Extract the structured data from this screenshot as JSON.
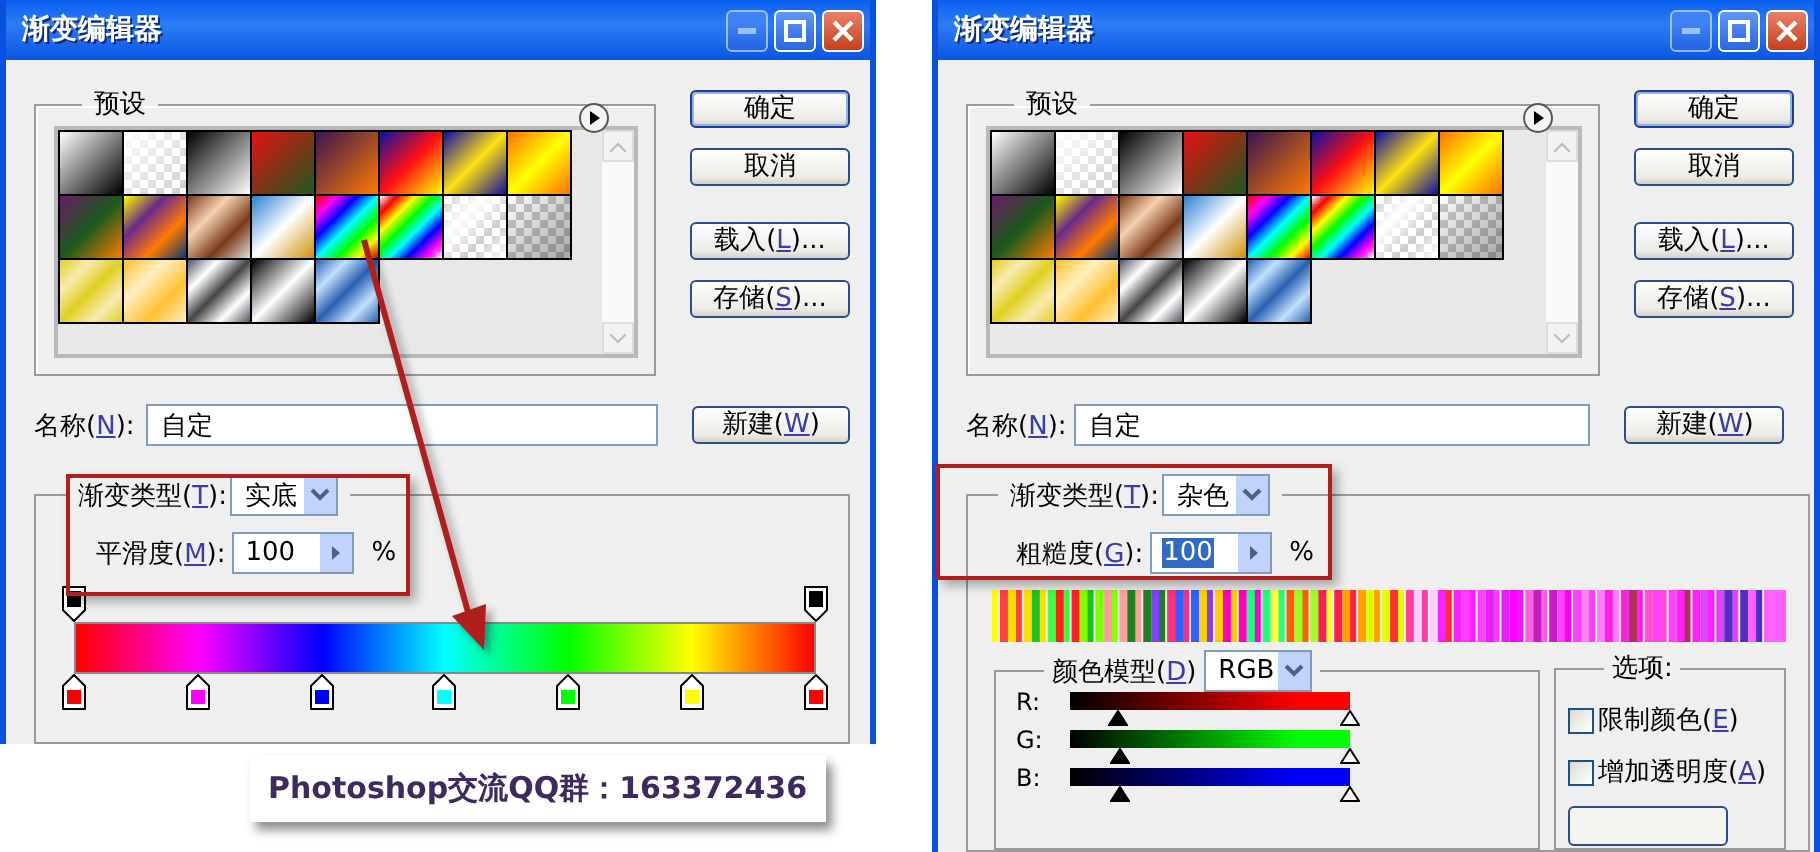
{
  "dialogs": [
    {
      "kind": "solid",
      "title": "渐变编辑器",
      "presets_label": "预设",
      "buttons": [
        {
          "label": {
            "before": "确定"
          },
          "default": true
        },
        {
          "label": {
            "before": "取消"
          },
          "default": false
        },
        {
          "label": {
            "before": "载入(",
            "key": "L",
            "after": ")..."
          },
          "default": false
        },
        {
          "label": {
            "before": "存储(",
            "key": "S",
            "after": ")..."
          },
          "default": false
        }
      ],
      "name_field": {
        "label": {
          "before": "名称(",
          "key": "N",
          "after": "):"
        },
        "value": "自定"
      },
      "new_button": {
        "before": "新建(",
        "key": "W",
        "after": ")"
      },
      "gradient_type": {
        "label": {
          "before": "渐变类型(",
          "key": "T",
          "after": "):"
        },
        "value": "实底"
      },
      "amount": {
        "label": {
          "before": "平滑度(",
          "key": "M",
          "after": "):"
        },
        "value": "100",
        "unit": "%",
        "selected": false
      },
      "opacity_stops": [
        {
          "color": "#000000"
        },
        {
          "color": "#000000"
        }
      ],
      "color_stops": [
        {
          "color": "#ff0000"
        },
        {
          "color": "#ff00ff"
        },
        {
          "color": "#0000ff"
        },
        {
          "color": "#00ffff"
        },
        {
          "color": "#00ff00"
        },
        {
          "color": "#ffff00"
        },
        {
          "color": "#ff0000"
        }
      ]
    },
    {
      "kind": "noise",
      "title": "渐变编辑器",
      "presets_label": "预设",
      "buttons": [
        {
          "label": {
            "before": "确定"
          },
          "default": true
        },
        {
          "label": {
            "before": "取消"
          },
          "default": false
        },
        {
          "label": {
            "before": "载入(",
            "key": "L",
            "after": ")..."
          },
          "default": false
        },
        {
          "label": {
            "before": "存储(",
            "key": "S",
            "after": ")..."
          },
          "default": false
        }
      ],
      "name_field": {
        "label": {
          "before": "名称(",
          "key": "N",
          "after": "):"
        },
        "value": "自定"
      },
      "new_button": {
        "before": "新建(",
        "key": "W",
        "after": ")"
      },
      "gradient_type": {
        "label": {
          "before": "渐变类型(",
          "key": "T",
          "after": "):"
        },
        "value": "杂色"
      },
      "amount": {
        "label": {
          "before": "粗糙度(",
          "key": "G",
          "after": "):"
        },
        "value": "100",
        "unit": "%",
        "selected": true
      },
      "color_model": {
        "label": {
          "before": "颜色模型(",
          "key": "D",
          "after": ")"
        },
        "value": "RGB"
      },
      "channels": [
        {
          "label": "R:",
          "color": "#ff0000",
          "thumbs": [
            {
              "level": 0.17
            },
            {
              "level": 1
            }
          ]
        },
        {
          "label": "G:",
          "color": "#00ff00",
          "thumbs": [
            {
              "level": 0.18
            },
            {
              "level": 1
            }
          ]
        },
        {
          "label": "B:",
          "color": "#0000ff",
          "thumbs": [
            {
              "level": 0.18
            },
            {
              "level": 1
            }
          ]
        }
      ],
      "options": {
        "title": "选项:",
        "checkboxes": [
          {
            "label": {
              "before": "限制颜色(",
              "key": "E",
              "after": ")"
            },
            "checked": false
          },
          {
            "label": {
              "before": "增加透明度(",
              "key": "A",
              "after": ")"
            },
            "checked": false
          }
        ]
      }
    }
  ],
  "caption": "Photoshop交流QQ群：163372436"
}
